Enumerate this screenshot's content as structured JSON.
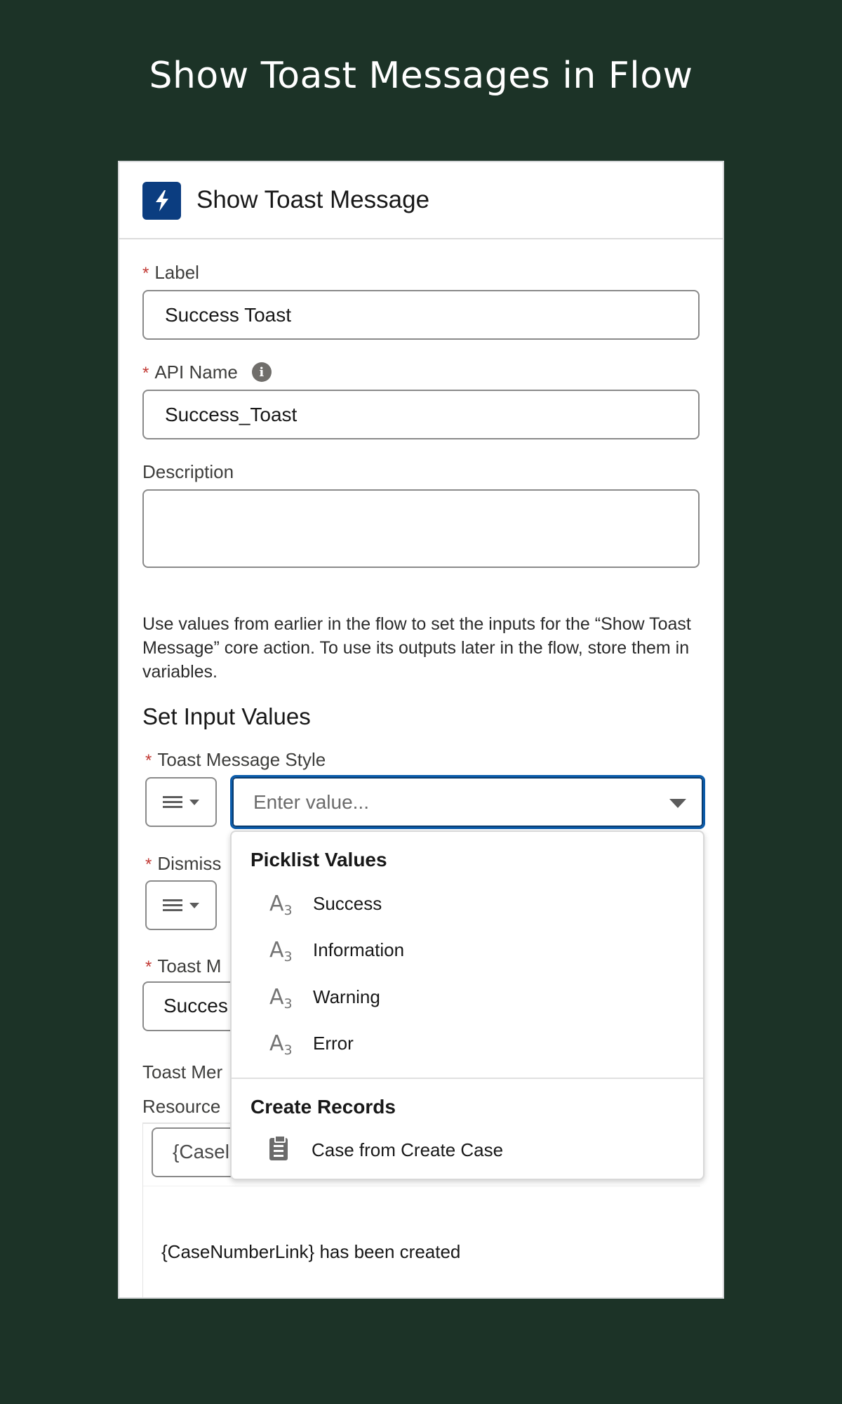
{
  "page": {
    "heading": "Show Toast Messages in Flow"
  },
  "colors": {
    "background": "#1c3327",
    "accent": "#0b3d80",
    "focus": "#0b5cab",
    "required": "#c23934"
  },
  "card": {
    "title": "Show Toast Message",
    "title_icon": "lightning-bolt-icon"
  },
  "form": {
    "required_marker": "*",
    "label_field": {
      "label": "Label",
      "value": "Success Toast"
    },
    "api_name_field": {
      "label": "API Name",
      "value": "Success_Toast",
      "info_icon": "i"
    },
    "description_field": {
      "label": "Description",
      "value": ""
    },
    "help_text": "Use values from earlier in the flow to set the inputs for the “Show Toast Message” core action. To use its outputs later in the flow, store them in variables.",
    "section_title": "Set Input Values",
    "toast_style_field": {
      "label": "Toast Message Style",
      "placeholder": "Enter value..."
    },
    "dismiss_field": {
      "label_partial": "Dismiss"
    },
    "toast_message_field": {
      "label_partial": "Toast M",
      "value_partial": "Succes"
    },
    "toast_message_link_label_partial": "Toast Mer",
    "resource_label_partial": "Resource",
    "resource_value_partial": "{Casel",
    "message_body": "{CaseNumberLink} has been created"
  },
  "dropdown": {
    "picklist_header": "Picklist Values",
    "picklist_icon": "A",
    "picklist_icon_sub": "3",
    "picklist_items": [
      "Success",
      "Information",
      "Warning",
      "Error"
    ],
    "records_header": "Create Records",
    "records_items": [
      "Case from Create Case"
    ]
  }
}
